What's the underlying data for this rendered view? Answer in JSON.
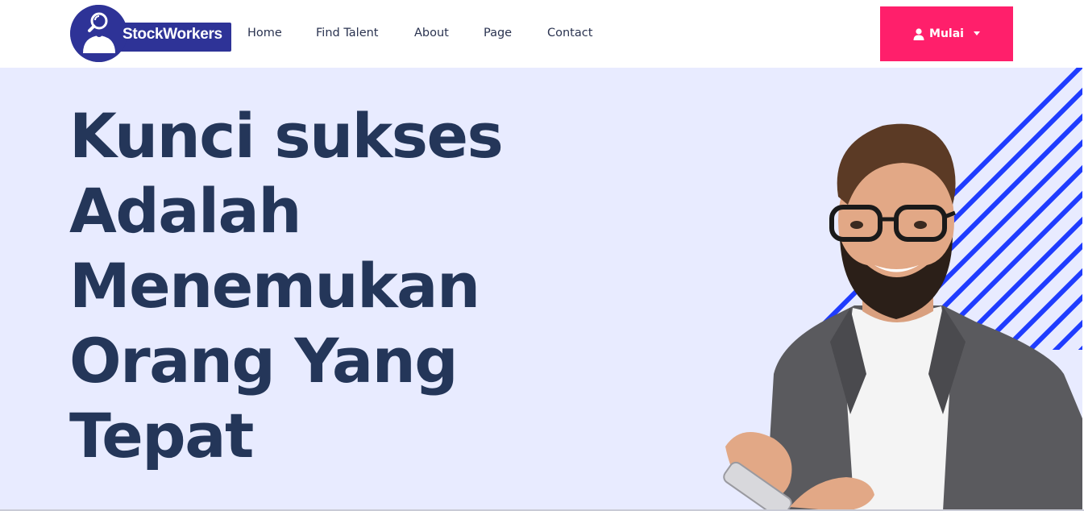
{
  "brand": {
    "name": "StockWorkers",
    "color": "#2e3397"
  },
  "nav": {
    "items": [
      {
        "label": "Home"
      },
      {
        "label": "Find Talent"
      },
      {
        "label": "About"
      },
      {
        "label": "Page"
      },
      {
        "label": "Contact"
      }
    ]
  },
  "cta": {
    "label": "Mulai",
    "icon": "user-icon",
    "dropdown_icon": "caret-down-icon",
    "color": "#ff1f6b"
  },
  "hero": {
    "headline_lines": [
      "Kunci sukses",
      "Adalah",
      "Menemukan",
      "Orang Yang",
      "Tepat"
    ],
    "background_color": "#e8ebff",
    "headline_color": "#243659",
    "stripe_color": "#1f3cff",
    "image": "man-with-glasses-holding-phone"
  }
}
